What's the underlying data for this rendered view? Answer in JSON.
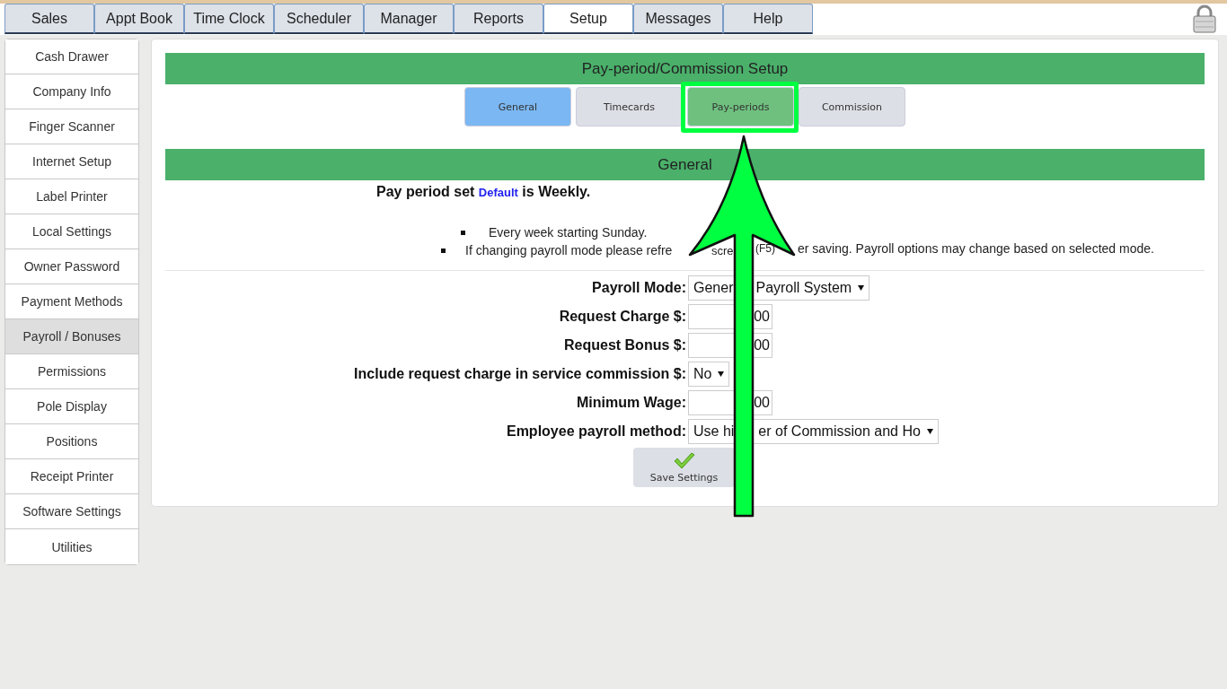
{
  "top_tabs": [
    {
      "label": "Sales",
      "selected": false
    },
    {
      "label": "Appt Book",
      "selected": false
    },
    {
      "label": "Time Clock",
      "selected": false
    },
    {
      "label": "Scheduler",
      "selected": false
    },
    {
      "label": "Manager",
      "selected": false
    },
    {
      "label": "Reports",
      "selected": false
    },
    {
      "label": "Setup",
      "selected": true
    },
    {
      "label": "Messages",
      "selected": false
    },
    {
      "label": "Help",
      "selected": false
    }
  ],
  "sidebar": {
    "items": [
      {
        "label": "Cash Drawer",
        "selected": false
      },
      {
        "label": "Company Info",
        "selected": false
      },
      {
        "label": "Finger Scanner",
        "selected": false
      },
      {
        "label": "Internet Setup",
        "selected": false
      },
      {
        "label": "Label Printer",
        "selected": false
      },
      {
        "label": "Local Settings",
        "selected": false
      },
      {
        "label": "Owner Password",
        "selected": false
      },
      {
        "label": "Payment Methods",
        "selected": false
      },
      {
        "label": "Payroll / Bonuses",
        "selected": true
      },
      {
        "label": "Permissions",
        "selected": false
      },
      {
        "label": "Pole Display",
        "selected": false
      },
      {
        "label": "Positions",
        "selected": false
      },
      {
        "label": "Receipt Printer",
        "selected": false
      },
      {
        "label": "Software Settings",
        "selected": false
      },
      {
        "label": "Utilities",
        "selected": false
      }
    ]
  },
  "panel": {
    "title": "Pay-period/Commission Setup",
    "tabs": [
      {
        "label": "General",
        "selected": true,
        "highlighted": false
      },
      {
        "label": "Timecards",
        "selected": false,
        "highlighted": false
      },
      {
        "label": "Pay-periods",
        "selected": false,
        "highlighted": true
      },
      {
        "label": "Commission",
        "selected": false,
        "highlighted": false
      }
    ],
    "section_title": "General",
    "pay_period": {
      "prefix": "Pay period set",
      "link": "Default",
      "suffix": "is Weekly."
    },
    "notes": [
      [
        "Every week starting Sunday."
      ],
      [
        "If changing payroll mode please refre",
        "scre",
        "(F5)",
        "er saving. Payroll options may change based on selected mode."
      ]
    ],
    "form": [
      {
        "label": "Payroll Mode:",
        "kind": "select",
        "value": [
          "Gener",
          "Payroll System"
        ]
      },
      {
        "label": "Request Charge $:",
        "kind": "input",
        "value": [
          "00"
        ]
      },
      {
        "label": "Request Bonus $:",
        "kind": "input",
        "value": [
          "00"
        ]
      },
      {
        "label": "Include request charge in service commission $:",
        "kind": "select",
        "value": [
          "No"
        ]
      },
      {
        "label": "Minimum Wage:",
        "kind": "input",
        "value": [
          "00"
        ]
      },
      {
        "label": "Employee payroll method:",
        "kind": "select",
        "value": [
          "Use hi",
          "er of Commission and Ho"
        ]
      }
    ],
    "save_button": "Save Settings"
  }
}
